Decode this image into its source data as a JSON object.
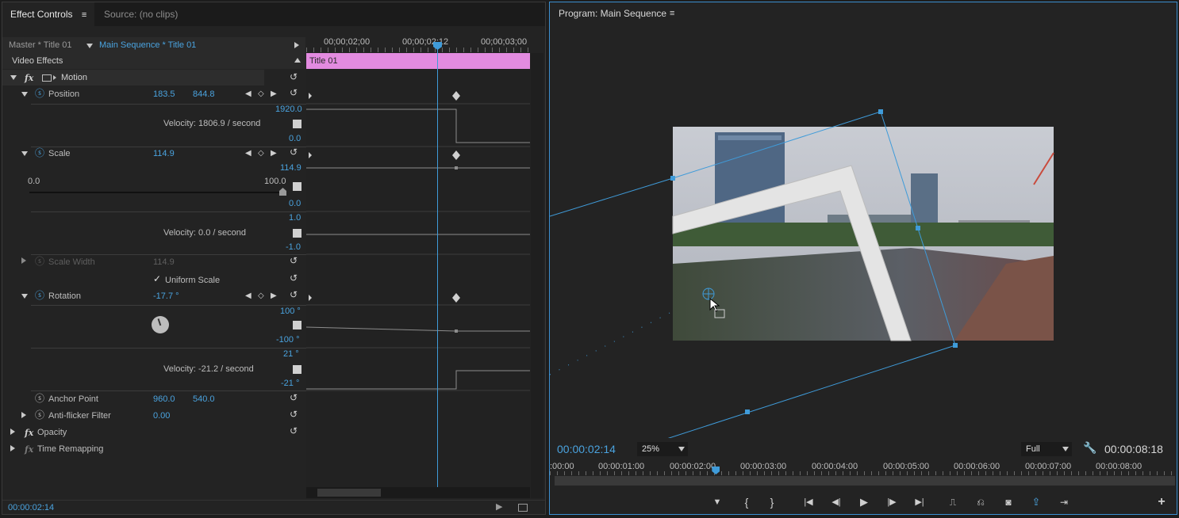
{
  "effect_controls": {
    "tab_label": "Effect Controls",
    "source_tab_label": "Source: (no clips)",
    "master_clip": "Master * Title 01",
    "sequence_clip": "Main Sequence * Title 01",
    "ruler_ticks": [
      "00;00;02;00",
      "00;00;02;12",
      "00;00;03;00"
    ],
    "clip_bar_label": "Title 01",
    "section_label": "Video Effects",
    "motion": {
      "label": "Motion",
      "position": {
        "label": "Position",
        "x": "183.5",
        "y": "844.8",
        "graph_max": "1920.0",
        "graph_min": "0.0",
        "velocity": "Velocity: 1806.9 / second"
      },
      "scale": {
        "label": "Scale",
        "value": "114.9",
        "graph_val": "114.9",
        "slider_min": "0.0",
        "slider_max": "100.0",
        "graph_min": "0.0",
        "vel_max": "1.0",
        "vel_min": "-1.0",
        "velocity": "Velocity: 0.0 / second"
      },
      "scale_width": {
        "label": "Scale Width",
        "value": "114.9"
      },
      "uniform_scale": {
        "label": "Uniform Scale",
        "checked": true
      },
      "rotation": {
        "label": "Rotation",
        "value": "-17.7 °",
        "graph_max": "100 °",
        "graph_min": "-100 °",
        "vel_max": "21 °",
        "vel_min": "-21 °",
        "velocity": "Velocity: -21.2 / second"
      },
      "anchor_point": {
        "label": "Anchor Point",
        "x": "960.0",
        "y": "540.0"
      },
      "anti_flicker": {
        "label": "Anti-flicker Filter",
        "value": "0.00"
      }
    },
    "opacity_label": "Opacity",
    "time_remap_label": "Time Remapping",
    "timecode": "00:00:02:14"
  },
  "program_monitor": {
    "title": "Program: Main Sequence",
    "current_timecode": "00:00:02:14",
    "zoom": "25%",
    "quality": "Full",
    "duration": "00:00:08:18",
    "ruler_ticks": [
      ":00:00",
      "00:00:01:00",
      "00:00:02:00",
      "00:00:03:00",
      "00:00:04:00",
      "00:00:05:00",
      "00:00:06:00",
      "00:00:07:00",
      "00:00:08:00"
    ],
    "playhead_fraction": 0.26
  },
  "icons": {
    "menu": "≡",
    "reset": "↺",
    "stopwatch": "ⓢ",
    "fx": "fx",
    "prev_key": "◀",
    "add_key": "◇",
    "next_key": "▶",
    "keyframe": "◆",
    "add": "+",
    "check": "✓"
  },
  "colors": {
    "accent": "#4aa3df",
    "clip_bar": "#e38be0",
    "panel": "#232323"
  }
}
